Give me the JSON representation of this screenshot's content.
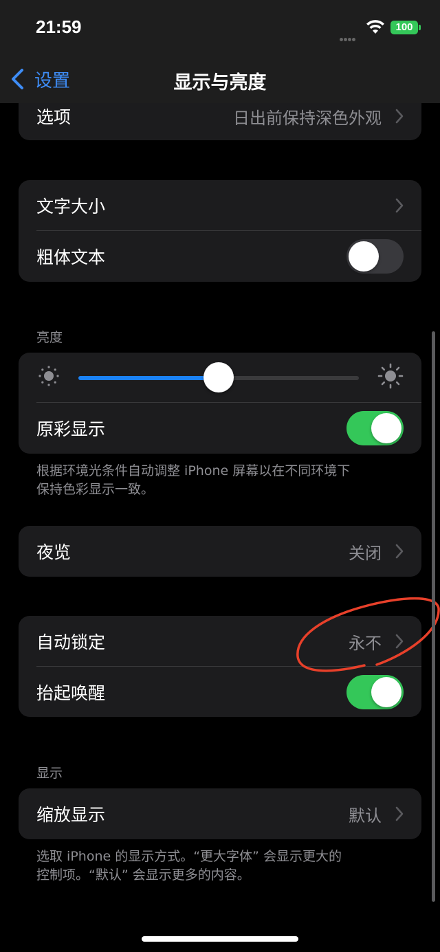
{
  "status_bar": {
    "time": "21:59",
    "battery": "100"
  },
  "nav": {
    "back_label": "设置",
    "title": "显示与亮度"
  },
  "appearance": {
    "options_label": "选项",
    "options_value": "日出前保持深色外观"
  },
  "text": {
    "text_size_label": "文字大小",
    "bold_text_label": "粗体文本",
    "bold_text_on": false
  },
  "brightness": {
    "header": "亮度",
    "level_percent": 50,
    "true_tone_label": "原彩显示",
    "true_tone_on": true,
    "footnote_line1": "根据环境光条件自动调整 iPhone 屏幕以在不同环境下",
    "footnote_line2": "保持色彩显示一致。"
  },
  "night_shift": {
    "label": "夜览",
    "value": "关闭"
  },
  "lock": {
    "auto_lock_label": "自动锁定",
    "auto_lock_value": "永不",
    "raise_to_wake_label": "抬起唤醒",
    "raise_to_wake_on": true
  },
  "display": {
    "header": "显示",
    "zoom_label": "缩放显示",
    "zoom_value": "默认",
    "footnote_line1": "选取 iPhone 的显示方式。“更大字体” 会显示更大的",
    "footnote_line2": "控制项。“默认” 会显示更多的内容。"
  },
  "colors": {
    "accent": "#3e8cf5",
    "toggle_on": "#34c759",
    "slider_fill": "#1a82f6",
    "annotation": "#e8402a"
  }
}
